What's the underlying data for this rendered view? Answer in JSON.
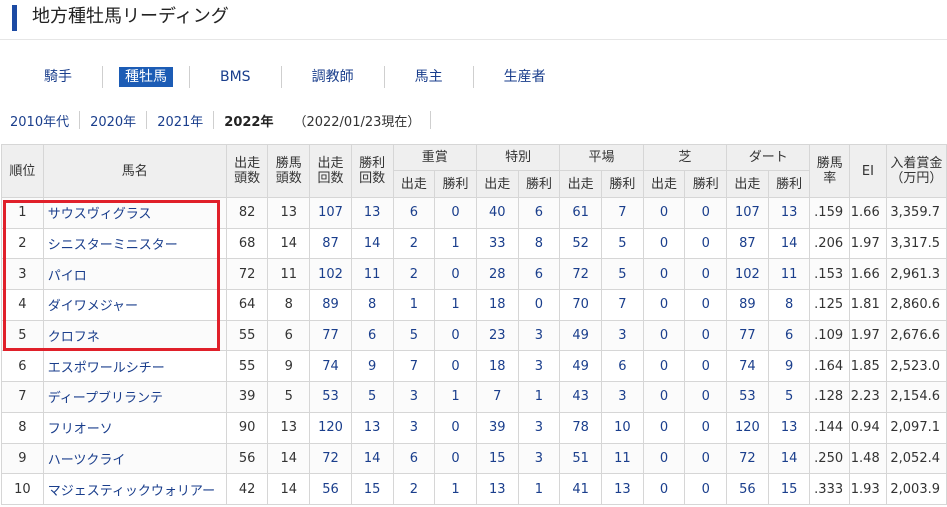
{
  "page_title": "地方種牡馬リーディング",
  "nav_tabs": [
    {
      "label": "騎手",
      "active": false
    },
    {
      "label": "種牡馬",
      "active": true
    },
    {
      "label": "BMS",
      "active": false
    },
    {
      "label": "調教師",
      "active": false
    },
    {
      "label": "馬主",
      "active": false
    },
    {
      "label": "生産者",
      "active": false
    }
  ],
  "years": [
    {
      "label": "2010年代",
      "current": false
    },
    {
      "label": "2020年",
      "current": false
    },
    {
      "label": "2021年",
      "current": false
    },
    {
      "label": "2022年",
      "current": true
    }
  ],
  "as_of_note": "（2022/01/23現在）",
  "table": {
    "headers": {
      "rank": "順位",
      "name": "馬名",
      "starters_a": "出走",
      "starters_b": "頭数",
      "winners_a": "勝馬",
      "winners_b": "頭数",
      "runs_a": "出走",
      "runs_b": "回数",
      "wins_a": "勝利",
      "wins_b": "回数",
      "graded": "重賞",
      "special": "特別",
      "flat": "平場",
      "turf": "芝",
      "dirt": "ダート",
      "sub_run": "出走",
      "sub_win": "勝利",
      "win_rate_a": "勝馬",
      "win_rate_b": "率",
      "ei": "EI",
      "earnings_a": "入着賞金",
      "earnings_b": "（万円）"
    },
    "rows": [
      {
        "rank": "1",
        "name": "サウスヴィグラス",
        "starters": "82",
        "winners": "13",
        "runs": "107",
        "wins": "13",
        "graded_runs": "6",
        "graded_wins": "0",
        "special_runs": "40",
        "special_wins": "6",
        "flat_runs": "61",
        "flat_wins": "7",
        "turf_runs": "0",
        "turf_wins": "0",
        "dirt_runs": "107",
        "dirt_wins": "13",
        "win_rate": ".159",
        "ei": "1.66",
        "earnings": "3,359.7"
      },
      {
        "rank": "2",
        "name": "シニスターミニスター",
        "starters": "68",
        "winners": "14",
        "runs": "87",
        "wins": "14",
        "graded_runs": "2",
        "graded_wins": "1",
        "special_runs": "33",
        "special_wins": "8",
        "flat_runs": "52",
        "flat_wins": "5",
        "turf_runs": "0",
        "turf_wins": "0",
        "dirt_runs": "87",
        "dirt_wins": "14",
        "win_rate": ".206",
        "ei": "1.97",
        "earnings": "3,317.5"
      },
      {
        "rank": "3",
        "name": "パイロ",
        "starters": "72",
        "winners": "11",
        "runs": "102",
        "wins": "11",
        "graded_runs": "2",
        "graded_wins": "0",
        "special_runs": "28",
        "special_wins": "6",
        "flat_runs": "72",
        "flat_wins": "5",
        "turf_runs": "0",
        "turf_wins": "0",
        "dirt_runs": "102",
        "dirt_wins": "11",
        "win_rate": ".153",
        "ei": "1.66",
        "earnings": "2,961.3"
      },
      {
        "rank": "4",
        "name": "ダイワメジャー",
        "starters": "64",
        "winners": "8",
        "runs": "89",
        "wins": "8",
        "graded_runs": "1",
        "graded_wins": "1",
        "special_runs": "18",
        "special_wins": "0",
        "flat_runs": "70",
        "flat_wins": "7",
        "turf_runs": "0",
        "turf_wins": "0",
        "dirt_runs": "89",
        "dirt_wins": "8",
        "win_rate": ".125",
        "ei": "1.81",
        "earnings": "2,860.6"
      },
      {
        "rank": "5",
        "name": "クロフネ",
        "starters": "55",
        "winners": "6",
        "runs": "77",
        "wins": "6",
        "graded_runs": "5",
        "graded_wins": "0",
        "special_runs": "23",
        "special_wins": "3",
        "flat_runs": "49",
        "flat_wins": "3",
        "turf_runs": "0",
        "turf_wins": "0",
        "dirt_runs": "77",
        "dirt_wins": "6",
        "win_rate": ".109",
        "ei": "1.97",
        "earnings": "2,676.6"
      },
      {
        "rank": "6",
        "name": "エスポワールシチー",
        "starters": "55",
        "winners": "9",
        "runs": "74",
        "wins": "9",
        "graded_runs": "7",
        "graded_wins": "0",
        "special_runs": "18",
        "special_wins": "3",
        "flat_runs": "49",
        "flat_wins": "6",
        "turf_runs": "0",
        "turf_wins": "0",
        "dirt_runs": "74",
        "dirt_wins": "9",
        "win_rate": ".164",
        "ei": "1.85",
        "earnings": "2,523.0"
      },
      {
        "rank": "7",
        "name": "ディープブリランテ",
        "starters": "39",
        "winners": "5",
        "runs": "53",
        "wins": "5",
        "graded_runs": "3",
        "graded_wins": "1",
        "special_runs": "7",
        "special_wins": "1",
        "flat_runs": "43",
        "flat_wins": "3",
        "turf_runs": "0",
        "turf_wins": "0",
        "dirt_runs": "53",
        "dirt_wins": "5",
        "win_rate": ".128",
        "ei": "2.23",
        "earnings": "2,154.6"
      },
      {
        "rank": "8",
        "name": "フリオーソ",
        "starters": "90",
        "winners": "13",
        "runs": "120",
        "wins": "13",
        "graded_runs": "3",
        "graded_wins": "0",
        "special_runs": "39",
        "special_wins": "3",
        "flat_runs": "78",
        "flat_wins": "10",
        "turf_runs": "0",
        "turf_wins": "0",
        "dirt_runs": "120",
        "dirt_wins": "13",
        "win_rate": ".144",
        "ei": "0.94",
        "earnings": "2,097.1"
      },
      {
        "rank": "9",
        "name": "ハーツクライ",
        "starters": "56",
        "winners": "14",
        "runs": "72",
        "wins": "14",
        "graded_runs": "6",
        "graded_wins": "0",
        "special_runs": "15",
        "special_wins": "3",
        "flat_runs": "51",
        "flat_wins": "11",
        "turf_runs": "0",
        "turf_wins": "0",
        "dirt_runs": "72",
        "dirt_wins": "14",
        "win_rate": ".250",
        "ei": "1.48",
        "earnings": "2,052.4"
      },
      {
        "rank": "10",
        "name": "マジェスティックウォリアー",
        "starters": "42",
        "winners": "14",
        "runs": "56",
        "wins": "15",
        "graded_runs": "2",
        "graded_wins": "1",
        "special_runs": "13",
        "special_wins": "1",
        "flat_runs": "41",
        "flat_wins": "13",
        "turf_runs": "0",
        "turf_wins": "0",
        "dirt_runs": "56",
        "dirt_wins": "15",
        "win_rate": ".333",
        "ei": "1.93",
        "earnings": "2,003.9"
      }
    ]
  },
  "colors": {
    "accent": "#1c4aa3",
    "active_tab": "#1c5cb5",
    "link": "#1a3e8c",
    "highlight": "#e0202a",
    "header_bg": "#efefef"
  }
}
